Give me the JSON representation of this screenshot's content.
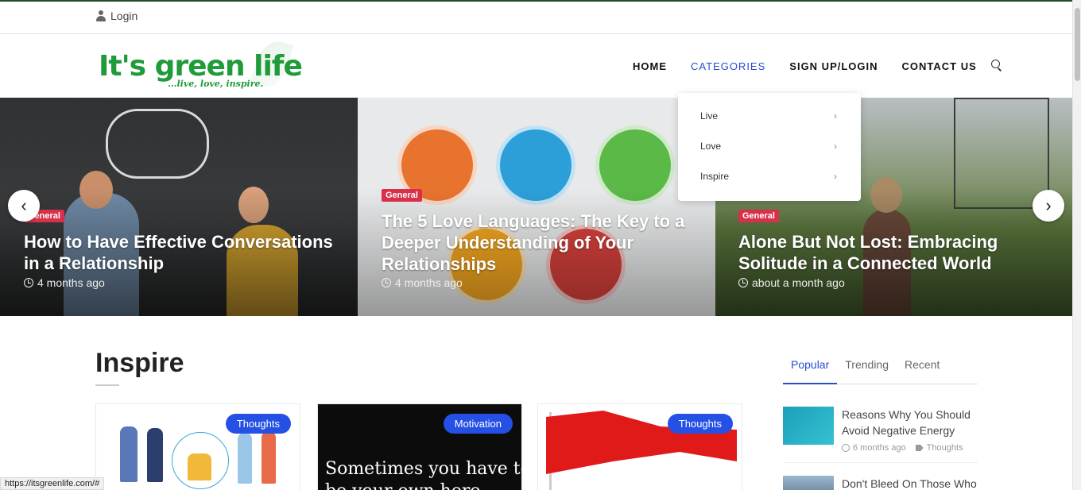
{
  "topbar": {
    "login_label": "Login"
  },
  "logo": {
    "text": "It's green life",
    "tagline": "...live, love, inspire."
  },
  "nav": {
    "items": [
      {
        "label": "HOME"
      },
      {
        "label": "CATEGORIES"
      },
      {
        "label": "SIGN UP/LOGIN"
      },
      {
        "label": "CONTACT US"
      }
    ],
    "active": "CATEGORIES",
    "accent_color": "#2b4bd1"
  },
  "dropdown": {
    "items": [
      {
        "label": "Live",
        "chevron": "›"
      },
      {
        "label": "Love",
        "chevron": "›"
      },
      {
        "label": "Inspire",
        "chevron": "›"
      }
    ]
  },
  "slider": {
    "prev_icon": "‹",
    "next_icon": "›",
    "slides": [
      {
        "badge": "General",
        "title": "How to Have Effective Conversations in a Relationship",
        "time": "4 months ago"
      },
      {
        "badge": "General",
        "title": "The 5 Love Languages: The Key to a Deeper Understanding of Your Relationships",
        "time": "4 months ago"
      },
      {
        "badge": "General",
        "title": "Alone But Not Lost: Embracing Solitude in a Connected World",
        "time": "about a month ago"
      }
    ],
    "badge_color": "#d9304a"
  },
  "section": {
    "title": "Inspire",
    "cards": [
      {
        "tag": "Thoughts"
      },
      {
        "tag": "Motivation",
        "image_text": "Sometimes you have to",
        "image_text2": "be your own hero"
      },
      {
        "tag": "Thoughts"
      }
    ],
    "tag_color": "#2550e6"
  },
  "sidebar": {
    "tabs": [
      {
        "label": "Popular"
      },
      {
        "label": "Trending"
      },
      {
        "label": "Recent"
      }
    ],
    "active_tab": "Popular",
    "posts": [
      {
        "title": "Reasons Why You Should Avoid Negative Energy",
        "time": "6 months ago",
        "category": "Thoughts"
      },
      {
        "title": "Don't Bleed On Those Who"
      }
    ]
  },
  "statusbar": {
    "url": "https://itsgreenlife.com/#"
  }
}
